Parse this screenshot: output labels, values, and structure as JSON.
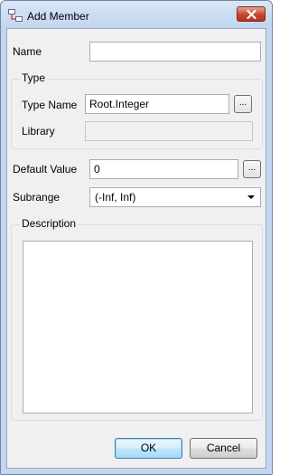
{
  "window": {
    "title": "Add Member",
    "icon": "hierarchy-icon",
    "close_icon": "close-icon"
  },
  "form": {
    "name_label": "Name",
    "name_value": "",
    "type_group_caption": "Type",
    "type_name_label": "Type Name",
    "type_name_value": "Root.Integer",
    "type_name_browse": "...",
    "library_label": "Library",
    "library_value": "",
    "default_value_label": "Default Value",
    "default_value": "0",
    "default_value_browse": "...",
    "subrange_label": "Subrange",
    "subrange_selected": "(-Inf, Inf)",
    "description_caption": "Description",
    "description_value": ""
  },
  "buttons": {
    "ok_label": "OK",
    "cancel_label": "Cancel"
  },
  "colors": {
    "close_button": "#c7442b",
    "window_frame": "#c4d6ec",
    "client_bg": "#f0f0f0"
  }
}
